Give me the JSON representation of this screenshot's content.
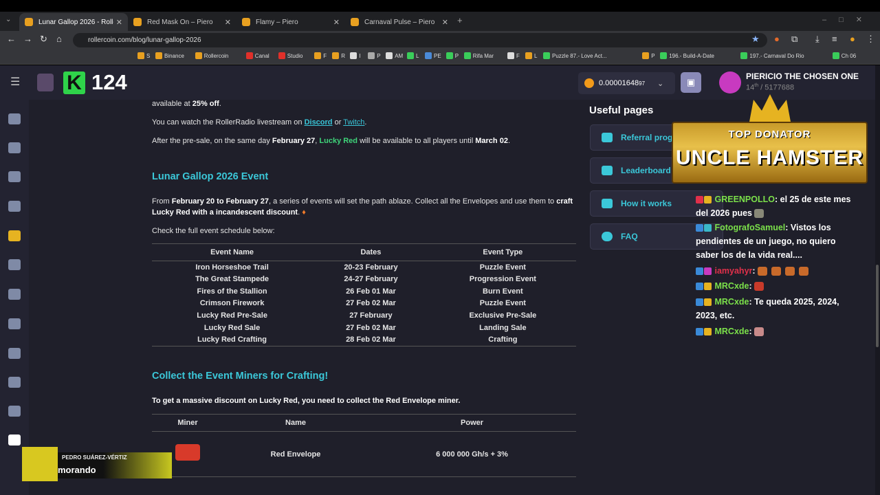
{
  "browser": {
    "tabs": [
      {
        "label": "Lunar Gallop 2026 - RollerCoin",
        "active": true
      },
      {
        "label": "Red Mask On – Piero",
        "active": false
      },
      {
        "label": "Flamy – Piero",
        "active": false
      },
      {
        "label": "Carnaval Pulse – Piero",
        "active": false
      }
    ],
    "url": "rollercoin.com/blog/lunar-gallop-2026",
    "bookmarks": [
      "S",
      "Binance",
      "Rollercoin",
      "Canal",
      "Studio",
      "F",
      "R",
      "I",
      "P",
      "AM",
      "L",
      "PE",
      "P",
      "Rifa Mar",
      "F",
      "L",
      "Puzzle 87.- Love Act...",
      "P",
      "196.- Build-A-Date",
      "197.- Carnaval Do Rio",
      "Ch 06"
    ]
  },
  "topbar": {
    "level": "124",
    "balance": "0.00001648",
    "balance_small": "97",
    "username": "PIERICIO THE CHOSEN ONE",
    "rank_sup": "th",
    "rank": "14",
    "rank_total": "/ 5177688"
  },
  "article": {
    "line_top": "available at",
    "line_top_b": "25% off",
    "line_top_end": ".",
    "radio_1": "You can watch the RollerRadio livestream on",
    "radio_link1": "Discord",
    "radio_or": "or",
    "radio_link2": "Twitch",
    "radio_end": ".",
    "presale_1": "After the pre-sale, on the same day",
    "presale_b": "February 27",
    "presale_2": ",",
    "presale_lucky": "Lucky Red",
    "presale_3": "will be available to all players until",
    "presale_date": "March 02",
    "presale_end": ".",
    "event_title": "Lunar Gallop 2026 Event",
    "event_p1": "From",
    "event_range": "February 20 to February 27",
    "event_p2": ", a series of events will set the path ablaze. Collect all the Envelopes and use them to",
    "event_b": "craft Lucky Red with a incandescent discount",
    "event_end": ".",
    "schedule_intro": "Check the full event schedule below:",
    "table_headers": [
      "Event Name",
      "Dates",
      "Event Type"
    ],
    "events": [
      {
        "name": "Iron Horseshoe Trail",
        "dates": "20-23 February",
        "type": "Puzzle Event"
      },
      {
        "name": "The Great Stampede",
        "dates": "24-27 February",
        "type": "Progression Event"
      },
      {
        "name": "Fires of the Stallion",
        "dates": "26 Feb 01 Mar",
        "type": "Burn Event"
      },
      {
        "name": "Crimson Firework",
        "dates": "27 Feb 02 Mar",
        "type": "Puzzle Event"
      },
      {
        "name": "Lucky Red Pre-Sale",
        "dates": "27 February",
        "type": "Exclusive Pre-Sale"
      },
      {
        "name": "Lucky Red Sale",
        "dates": "27 Feb 02 Mar",
        "type": "Landing Sale"
      },
      {
        "name": "Lucky Red Crafting",
        "dates": "28 Feb 02 Mar",
        "type": "Crafting"
      }
    ],
    "collect_title": "Collect the Event Miners for Crafting!",
    "collect_text": "To get a massive discount on Lucky Red, you need to collect the Red Envelope miner.",
    "miner_headers": [
      "Miner",
      "Name",
      "Power"
    ],
    "miner": {
      "name": "Red Envelope",
      "power": "6 000 000 Gh/s + 3%"
    }
  },
  "useful": {
    "title": "Useful pages",
    "items": [
      "Referral progr",
      "Leaderboard",
      "How it works",
      "FAQ"
    ]
  },
  "banner": {
    "line1": "TOP DONATOR",
    "line2": "UNCLE HAMSTER"
  },
  "chat": [
    {
      "user": "GREENPOLLO",
      "text": ": el 25 de este mes del 2026 pues",
      "color": "#7be04a"
    },
    {
      "user": "FotografoSamuel",
      "text": ": Vistos los pendientes de un juego, no quiero saber los de la vida real....",
      "color": "#7be04a"
    },
    {
      "user": "iamyahyr",
      "text": ":",
      "color": "#e0304a"
    },
    {
      "user": "MRCxde",
      "text": ":",
      "color": "#7be04a"
    },
    {
      "user": "MRCxde",
      "text": ": Te queda 2025, 2024, 2023, etc.",
      "color": "#7be04a"
    },
    {
      "user": "MRCxde",
      "text": ":",
      "color": "#7be04a"
    }
  ],
  "overlay": {
    "name": "PEDRO SUÁREZ-VÉRTIZ",
    "song": "morando"
  },
  "colors": {
    "accent": "#39c5d8",
    "bg": "#1f1f2a",
    "lucky": "#3fd47a"
  }
}
